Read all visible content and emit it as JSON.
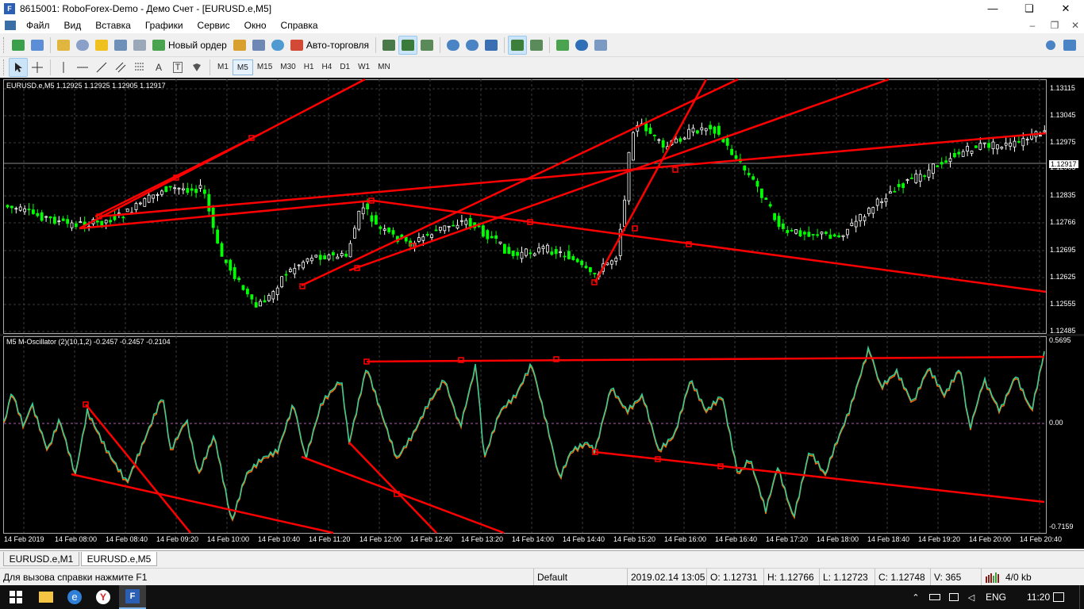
{
  "window": {
    "title": "8615001: RoboForex-Demo - Демо Счет - [EURUSD.e,M5]",
    "app_icon": "metatrader-icon"
  },
  "menu": [
    "Файл",
    "Вид",
    "Вставка",
    "Графики",
    "Сервис",
    "Окно",
    "Справка"
  ],
  "toolbar": {
    "new_order": "Новый ордер",
    "autotrading": "Авто-торговля"
  },
  "timeframes": [
    "M1",
    "M5",
    "M15",
    "M30",
    "H1",
    "H4",
    "D1",
    "W1",
    "MN"
  ],
  "active_timeframe": "M5",
  "chart": {
    "symbol_info": "EURUSD.e,M5  1.12925 1.12925 1.12905 1.12917",
    "price_axis": [
      "1.13115",
      "1.13045",
      "1.12975",
      "1.12905",
      "1.12835",
      "1.12766",
      "1.12695",
      "1.12625",
      "1.12555",
      "1.12485"
    ],
    "current_price": "1.12917",
    "indicator_info": "M5  M-Oscillator (2)(10,1,2) -0.2457 -0.2457 -0.2104",
    "osc_axis": [
      "0.5695",
      "0.00",
      "-0.7159"
    ],
    "time_axis": [
      "14 Feb 2019",
      "14 Feb 08:00",
      "14 Feb 08:40",
      "14 Feb 09:20",
      "14 Feb 10:00",
      "14 Feb 10:40",
      "14 Feb 11:20",
      "14 Feb 12:00",
      "14 Feb 12:40",
      "14 Feb 13:20",
      "14 Feb 14:00",
      "14 Feb 14:40",
      "14 Feb 15:20",
      "14 Feb 16:00",
      "14 Feb 16:40",
      "14 Feb 17:20",
      "14 Feb 18:00",
      "14 Feb 18:40",
      "14 Feb 19:20",
      "14 Feb 20:00",
      "14 Feb 20:40"
    ],
    "colors": {
      "background": "#000000",
      "bull": "#ffffff",
      "bear": "#00ff00",
      "trendline": "#ff0000",
      "osc_fast": "#ff6a00",
      "osc_slow": "#2ecf9a"
    }
  },
  "tabs": [
    "EURUSD.e,M1",
    "EURUSD.e,M5"
  ],
  "active_tab": "EURUSD.e,M5",
  "status": {
    "help": "Для вызова справки нажмите F1",
    "profile": "Default",
    "datetime": "2019.02.14 13:05",
    "open": "O: 1.12731",
    "high": "H: 1.12766",
    "low": "L: 1.12723",
    "close": "C: 1.12748",
    "volume": "V: 365",
    "traffic": "4/0 kb"
  },
  "taskbar": {
    "lang": "ENG",
    "time": "11:20"
  }
}
